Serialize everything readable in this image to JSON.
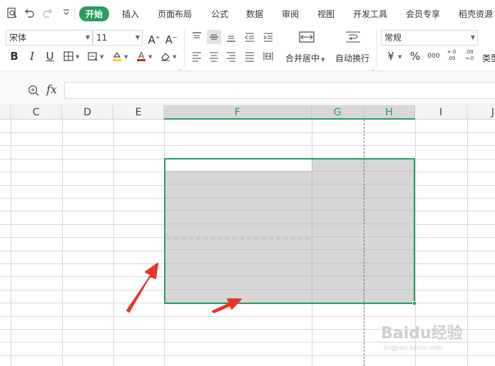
{
  "menubar": {
    "tabs": [
      {
        "label": "开始",
        "active": true
      },
      {
        "label": "插入"
      },
      {
        "label": "页面布局"
      },
      {
        "label": "公式"
      },
      {
        "label": "数据"
      },
      {
        "label": "审阅"
      },
      {
        "label": "视图"
      },
      {
        "label": "开发工具"
      },
      {
        "label": "会员专享"
      },
      {
        "label": "稻壳资源"
      }
    ],
    "quick_access": [
      "print-preview-icon",
      "undo-icon",
      "redo-icon",
      "customize-dropdown-icon"
    ]
  },
  "ribbon": {
    "font_name": "宋体",
    "font_size": "11",
    "bold": "B",
    "italic": "I",
    "underline": "U",
    "merge_label": "合并居中",
    "wrap_label": "自动换行",
    "number_format": "常规",
    "currency_symbol": "¥",
    "percent_symbol": "%",
    "thousands_symbol": "000",
    "inc_decimal": "+.0 .00",
    "dec_decimal": ".00 →.0",
    "type_label": "类型"
  },
  "formula_bar": {
    "fx_label": "fx",
    "value": ""
  },
  "columns": [
    {
      "label": "C",
      "selected": false
    },
    {
      "label": "D",
      "selected": false
    },
    {
      "label": "E",
      "selected": false
    },
    {
      "label": "F",
      "selected": true
    },
    {
      "label": "G",
      "selected": true
    },
    {
      "label": "H",
      "selected": true
    },
    {
      "label": "I",
      "selected": false
    },
    {
      "label": "J",
      "selected": false
    }
  ],
  "colors": {
    "accent": "#2a9d5e",
    "selection_fill": "#d6d6d6",
    "arrow": "#e8332b"
  },
  "watermark": {
    "text": "Baidu经验",
    "sub": "jingyan.baidu.com"
  }
}
